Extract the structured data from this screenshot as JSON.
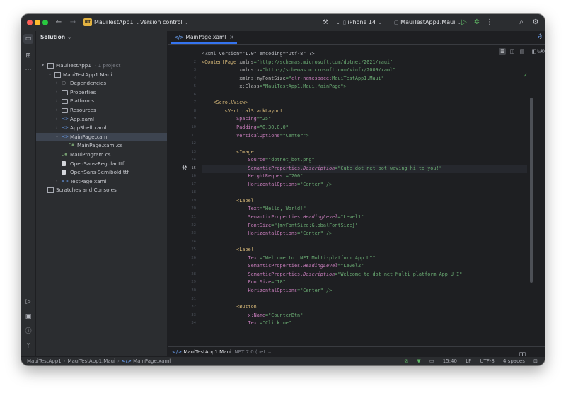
{
  "titlebar": {
    "project_badge": "RT",
    "project_name": "MauiTestApp1",
    "vcs": "Version control",
    "device": "iPhone 14",
    "run_config": "MauiTestApp1.Maui"
  },
  "panel": {
    "title": "Solution",
    "tree": [
      {
        "label": "MauiTestApp1",
        "suffix": "· 1 project",
        "icon": "solution",
        "indent": 0,
        "arrow": "▾"
      },
      {
        "label": "MauiTestApp1.Maui",
        "suffix": "",
        "icon": "project",
        "indent": 1,
        "arrow": "▾"
      },
      {
        "label": "Dependencies",
        "suffix": "",
        "icon": "dependencies",
        "indent": 2,
        "arrow": "›"
      },
      {
        "label": "Properties",
        "suffix": "",
        "icon": "folder",
        "indent": 2,
        "arrow": "›"
      },
      {
        "label": "Platforms",
        "suffix": "",
        "icon": "folder",
        "indent": 2,
        "arrow": "›"
      },
      {
        "label": "Resources",
        "suffix": "",
        "icon": "folder",
        "indent": 2,
        "arrow": "›"
      },
      {
        "label": "App.xaml",
        "suffix": "",
        "icon": "xaml",
        "indent": 2,
        "arrow": "›"
      },
      {
        "label": "AppShell.xaml",
        "suffix": "",
        "icon": "xaml",
        "indent": 2,
        "arrow": "›"
      },
      {
        "label": "MainPage.xaml",
        "suffix": "",
        "icon": "xaml",
        "indent": 2,
        "arrow": "▾",
        "selected": true
      },
      {
        "label": "MainPage.xaml.cs",
        "suffix": "",
        "icon": "cs",
        "indent": 3,
        "arrow": ""
      },
      {
        "label": "MauiProgram.cs",
        "suffix": "",
        "icon": "cs",
        "indent": 2,
        "arrow": ""
      },
      {
        "label": "OpenSans-Regular.ttf",
        "suffix": "",
        "icon": "font",
        "indent": 2,
        "arrow": ""
      },
      {
        "label": "OpenSans-Semibold.ttf",
        "suffix": "",
        "icon": "font",
        "indent": 2,
        "arrow": ""
      },
      {
        "label": "TestPage.xaml",
        "suffix": "",
        "icon": "xaml",
        "indent": 2,
        "arrow": "›"
      },
      {
        "label": "Scratches and Consoles",
        "suffix": "",
        "icon": "scratches",
        "indent": 0,
        "arrow": ""
      }
    ]
  },
  "editor": {
    "tab_label": "MainPage.xaml",
    "current_line": 15,
    "lines": [
      [
        {
          "t": "<?xml version=\"1.0\" encoding=\"utf-8\" ?>",
          "c": "c-punct"
        }
      ],
      [
        {
          "t": "<ContentPage ",
          "c": "c-tag"
        },
        {
          "t": "xmlns",
          "c": "c-attr"
        },
        {
          "t": "=\"http://schemas.microsoft.com/dotnet/2021/maui\"",
          "c": "c-str"
        }
      ],
      [
        {
          "t": "             ",
          "c": ""
        },
        {
          "t": "xmlns:x",
          "c": "c-attr"
        },
        {
          "t": "=\"http://schemas.microsoft.com/winfx/2009/xaml\"",
          "c": "c-str"
        }
      ],
      [
        {
          "t": "             ",
          "c": ""
        },
        {
          "t": "xmlns:myFontSize",
          "c": "c-attr"
        },
        {
          "t": "=\"",
          "c": "c-str"
        },
        {
          "t": "clr-namespace:",
          "c": "c-ns"
        },
        {
          "t": "MauiTestApp1.Maui\"",
          "c": "c-str"
        }
      ],
      [
        {
          "t": "             ",
          "c": ""
        },
        {
          "t": "x:Class",
          "c": "c-attr"
        },
        {
          "t": "=\"MauiTestApp1.Maui.MainPage\">",
          "c": "c-str"
        }
      ],
      [],
      [
        {
          "t": "    ",
          "c": ""
        },
        {
          "t": "<ScrollView>",
          "c": "c-tag"
        }
      ],
      [
        {
          "t": "        ",
          "c": ""
        },
        {
          "t": "<VerticalStackLayout",
          "c": "c-tag"
        }
      ],
      [
        {
          "t": "            ",
          "c": ""
        },
        {
          "t": "Spacing",
          "c": "c-ns"
        },
        {
          "t": "=\"25\"",
          "c": "c-str"
        }
      ],
      [
        {
          "t": "            ",
          "c": ""
        },
        {
          "t": "Padding",
          "c": "c-ns"
        },
        {
          "t": "=\"0,30,0,0\"",
          "c": "c-str"
        }
      ],
      [
        {
          "t": "            ",
          "c": ""
        },
        {
          "t": "VerticalOptions",
          "c": "c-ns"
        },
        {
          "t": "=\"Center\">",
          "c": "c-str"
        }
      ],
      [],
      [
        {
          "t": "            ",
          "c": ""
        },
        {
          "t": "<Image",
          "c": "c-tag"
        }
      ],
      [
        {
          "t": "                ",
          "c": ""
        },
        {
          "t": "Source",
          "c": "c-ns"
        },
        {
          "t": "=\"dotnet_bot.png\"",
          "c": "c-str"
        }
      ],
      [
        {
          "t": "                ",
          "c": ""
        },
        {
          "t": "SemanticProperties.",
          "c": "c-ns"
        },
        {
          "t": "Description",
          "c": "c-prop"
        },
        {
          "t": "=\"Cute dot net bot waving hi to you!\"",
          "c": "c-str"
        }
      ],
      [
        {
          "t": "                ",
          "c": ""
        },
        {
          "t": "HeightRequest",
          "c": "c-ns"
        },
        {
          "t": "=\"200\"",
          "c": "c-str"
        }
      ],
      [
        {
          "t": "                ",
          "c": ""
        },
        {
          "t": "HorizontalOptions",
          "c": "c-ns"
        },
        {
          "t": "=\"Center\" />",
          "c": "c-str"
        }
      ],
      [],
      [
        {
          "t": "            ",
          "c": ""
        },
        {
          "t": "<Label",
          "c": "c-tag"
        }
      ],
      [
        {
          "t": "                ",
          "c": ""
        },
        {
          "t": "Text",
          "c": "c-ns"
        },
        {
          "t": "=\"Hello, World!\"",
          "c": "c-str"
        }
      ],
      [
        {
          "t": "                ",
          "c": ""
        },
        {
          "t": "SemanticProperties.",
          "c": "c-ns"
        },
        {
          "t": "HeadingLevel",
          "c": "c-prop"
        },
        {
          "t": "=\"Level1\"",
          "c": "c-str"
        }
      ],
      [
        {
          "t": "                ",
          "c": ""
        },
        {
          "t": "FontSize",
          "c": "c-ns"
        },
        {
          "t": "=\"{myFontSize:GlobalFontSize}\"",
          "c": "c-str"
        }
      ],
      [
        {
          "t": "                ",
          "c": ""
        },
        {
          "t": "HorizontalOptions",
          "c": "c-ns"
        },
        {
          "t": "=\"Center\" />",
          "c": "c-str"
        }
      ],
      [],
      [
        {
          "t": "            ",
          "c": ""
        },
        {
          "t": "<Label",
          "c": "c-tag"
        }
      ],
      [
        {
          "t": "                ",
          "c": ""
        },
        {
          "t": "Text",
          "c": "c-ns"
        },
        {
          "t": "=\"Welcome to .NET Multi-platform App UI\"",
          "c": "c-str"
        }
      ],
      [
        {
          "t": "                ",
          "c": ""
        },
        {
          "t": "SemanticProperties.",
          "c": "c-ns"
        },
        {
          "t": "HeadingLevel",
          "c": "c-prop"
        },
        {
          "t": "=\"Level2\"",
          "c": "c-str"
        }
      ],
      [
        {
          "t": "                ",
          "c": ""
        },
        {
          "t": "SemanticProperties.",
          "c": "c-ns"
        },
        {
          "t": "Description",
          "c": "c-prop"
        },
        {
          "t": "=\"Welcome to dot net Multi platform App U I\"",
          "c": "c-str"
        }
      ],
      [
        {
          "t": "                ",
          "c": ""
        },
        {
          "t": "FontSize",
          "c": "c-ns"
        },
        {
          "t": "=\"18\"",
          "c": "c-str"
        }
      ],
      [
        {
          "t": "                ",
          "c": ""
        },
        {
          "t": "HorizontalOptions",
          "c": "c-ns"
        },
        {
          "t": "=\"Center\" />",
          "c": "c-str"
        }
      ],
      [],
      [
        {
          "t": "            ",
          "c": ""
        },
        {
          "t": "<Button",
          "c": "c-tag"
        }
      ],
      [
        {
          "t": "                ",
          "c": ""
        },
        {
          "t": "x:Name",
          "c": "c-ns"
        },
        {
          "t": "=\"CounterBtn\"",
          "c": "c-str"
        }
      ],
      [
        {
          "t": "                ",
          "c": ""
        },
        {
          "t": "Text",
          "c": "c-ns"
        },
        {
          "t": "=\"Click me\"",
          "c": "c-str"
        }
      ]
    ],
    "bottom_breadcrumb": "MauiTestApp1.Maui",
    "bottom_framework": ".NET 7.0 (net"
  },
  "statusbar": {
    "crumbs": [
      "MauiTestApp1",
      "MauiTestApp1.Maui",
      "MainPage.xaml"
    ],
    "position": "15:40",
    "line_ending": "LF",
    "encoding": "UTF-8",
    "indent": "4 spaces"
  }
}
